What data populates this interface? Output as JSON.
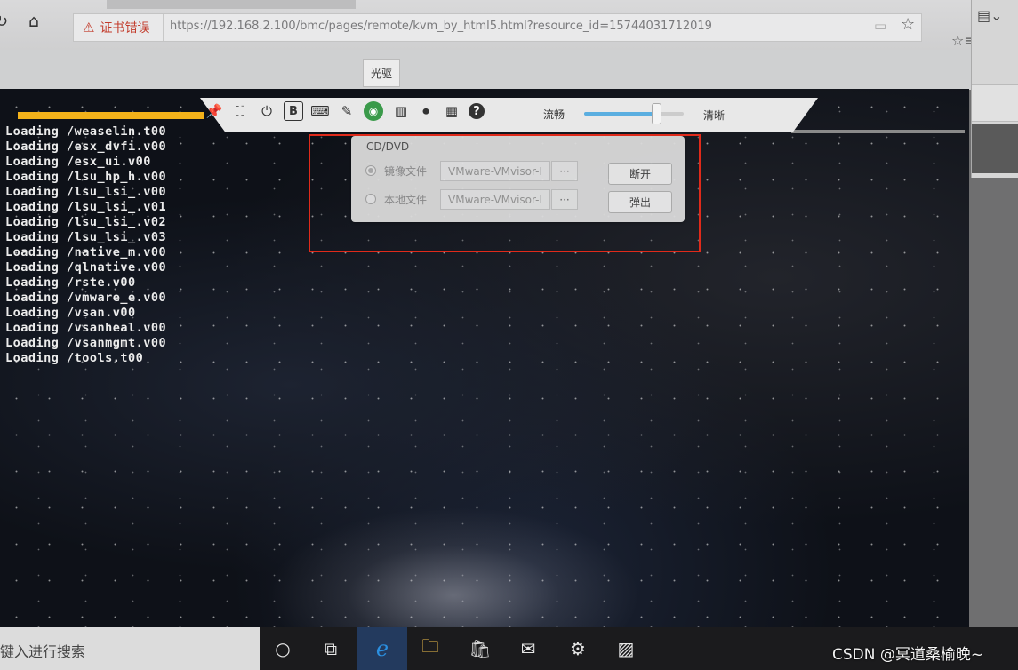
{
  "browser": {
    "cert_warning_label": "证书错误",
    "url": "https://192.168.2.100/bmc/pages/remote/kvm_by_html5.html?resource_id=15744031712019",
    "icons": [
      "refresh-icon",
      "home-icon",
      "warning-icon",
      "reader-view-icon",
      "favorite-star-icon",
      "favorites-list-icon"
    ]
  },
  "toolbar": {
    "tooltip": "光驱",
    "icons": [
      "pin-icon",
      "fullscreen-icon",
      "power-icon",
      "bold-b-icon",
      "keyboard-icon",
      "mouse-icon",
      "cdrom-icon",
      "floppy-icon",
      "record-icon",
      "keyboard-layout-icon",
      "help-icon"
    ],
    "speed_low_label": "流畅",
    "speed_high_label": "清晰",
    "quality_level": 0.72
  },
  "cd_dvd_panel": {
    "title": "CD/DVD",
    "options": [
      {
        "label": "镜像文件",
        "value": "VMware-VMvisor-I",
        "browse_label": "···",
        "selected": true
      },
      {
        "label": "本地文件",
        "value": "VMware-VMvisor-I",
        "browse_label": "···",
        "selected": false
      }
    ],
    "disconnect_label": "断开",
    "eject_label": "弹出"
  },
  "console": {
    "lines": [
      "Loading /weaselin.t00",
      "Loading /esx_dvfi.v00",
      "Loading /esx_ui.v00",
      "Loading /lsu_hp_h.v00",
      "Loading /lsu_lsi_.v00",
      "Loading /lsu_lsi_.v01",
      "Loading /lsu_lsi_.v02",
      "Loading /lsu_lsi_.v03",
      "Loading /native_m.v00",
      "Loading /qlnative.v00",
      "Loading /rste.v00",
      "Loading /vmware_e.v00",
      "Loading /vsan.v00",
      "Loading /vsanheal.v00",
      "Loading /vsanmgmt.v00",
      "Loading /tools.t00"
    ]
  },
  "taskbar": {
    "search_placeholder": "键入进行搜索",
    "icons": [
      "cortana-icon",
      "task-view-icon",
      "edge-icon",
      "file-explorer-icon",
      "store-icon",
      "mail-icon",
      "settings-icon",
      "photos-icon"
    ]
  },
  "watermark": "CSDN @冥道桑榆晚~"
}
